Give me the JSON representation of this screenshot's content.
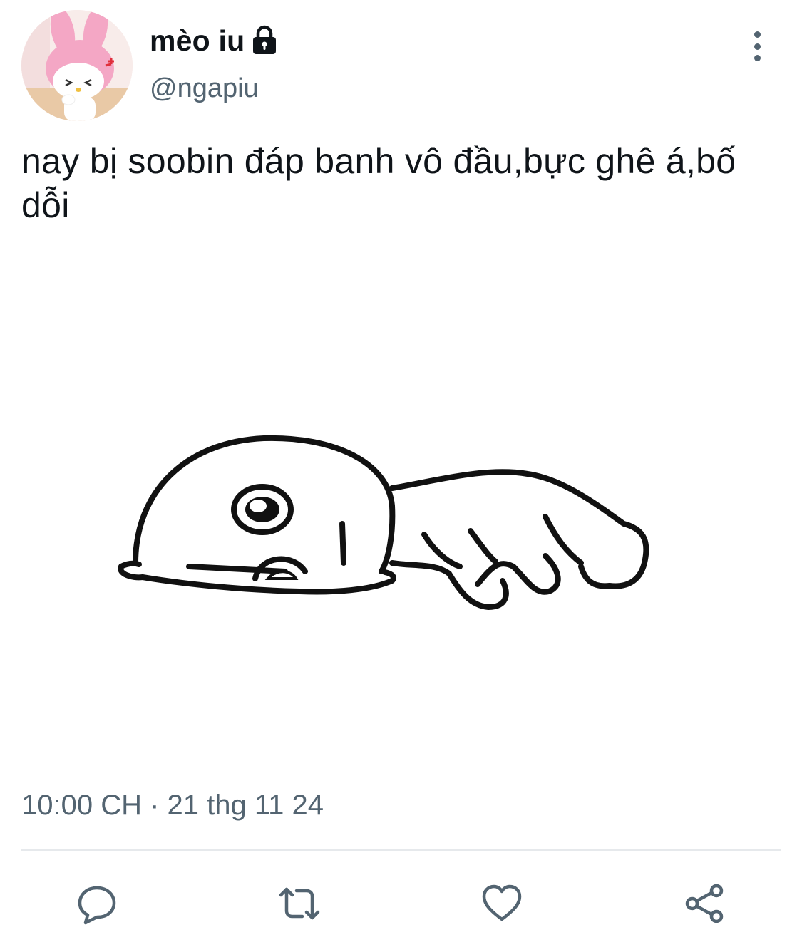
{
  "tweet": {
    "author": {
      "display_name": "mèo iu",
      "handle": "@ngapiu",
      "protected_icon": "lock-icon"
    },
    "text": "nay bị soobin đáp banh vô đầu,bực ghê á,bố dỗi",
    "timestamp": "10:00 CH · 21 thg 11 24"
  },
  "actions": {
    "reply_icon": "reply-icon",
    "retweet_icon": "retweet-icon",
    "like_icon": "heart-icon",
    "share_icon": "share-icon",
    "more_icon": "more-vertical-icon"
  },
  "colors": {
    "text_primary": "#0f1419",
    "text_secondary": "#536471",
    "icon": "#536471",
    "divider": "#e6e9ec",
    "avatar_pink": "#f2a6c4"
  }
}
